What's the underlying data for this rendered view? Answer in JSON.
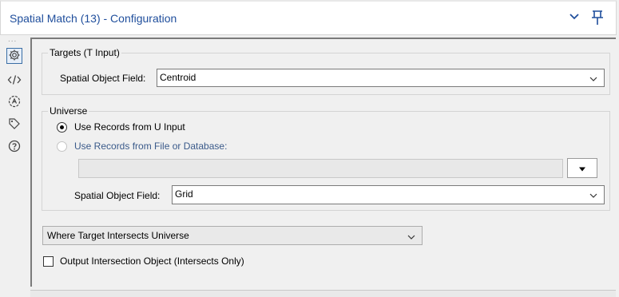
{
  "window": {
    "title": "Spatial Match (13) - Configuration",
    "icons": [
      "chevron-down-icon",
      "pin-icon"
    ],
    "colors": {
      "title_text": "#1f4e9c",
      "accent": "#3a6ea5"
    }
  },
  "sidebar": {
    "grip": "...",
    "items": [
      {
        "icon": "gear-icon",
        "active": true
      },
      {
        "icon": "code-icon",
        "active": false
      },
      {
        "icon": "compass-icon",
        "active": false
      },
      {
        "icon": "tag-icon",
        "active": false
      },
      {
        "icon": "help-icon",
        "active": false
      }
    ]
  },
  "targets": {
    "legend": "Targets (T Input)",
    "field_label": "Spatial Object Field:",
    "field_value": "Centroid"
  },
  "universe": {
    "legend": "Universe",
    "option_u_input": "Use Records from U Input",
    "option_file_db": "Use Records from File or Database:",
    "selected": "option_u_input",
    "file_path": "",
    "field_label": "Spatial Object Field:",
    "field_value": "Grid"
  },
  "match": {
    "action_value": "Where Target Intersects Universe"
  },
  "output": {
    "intersection_label": "Output Intersection Object (Intersects Only)",
    "intersection_checked": false
  }
}
